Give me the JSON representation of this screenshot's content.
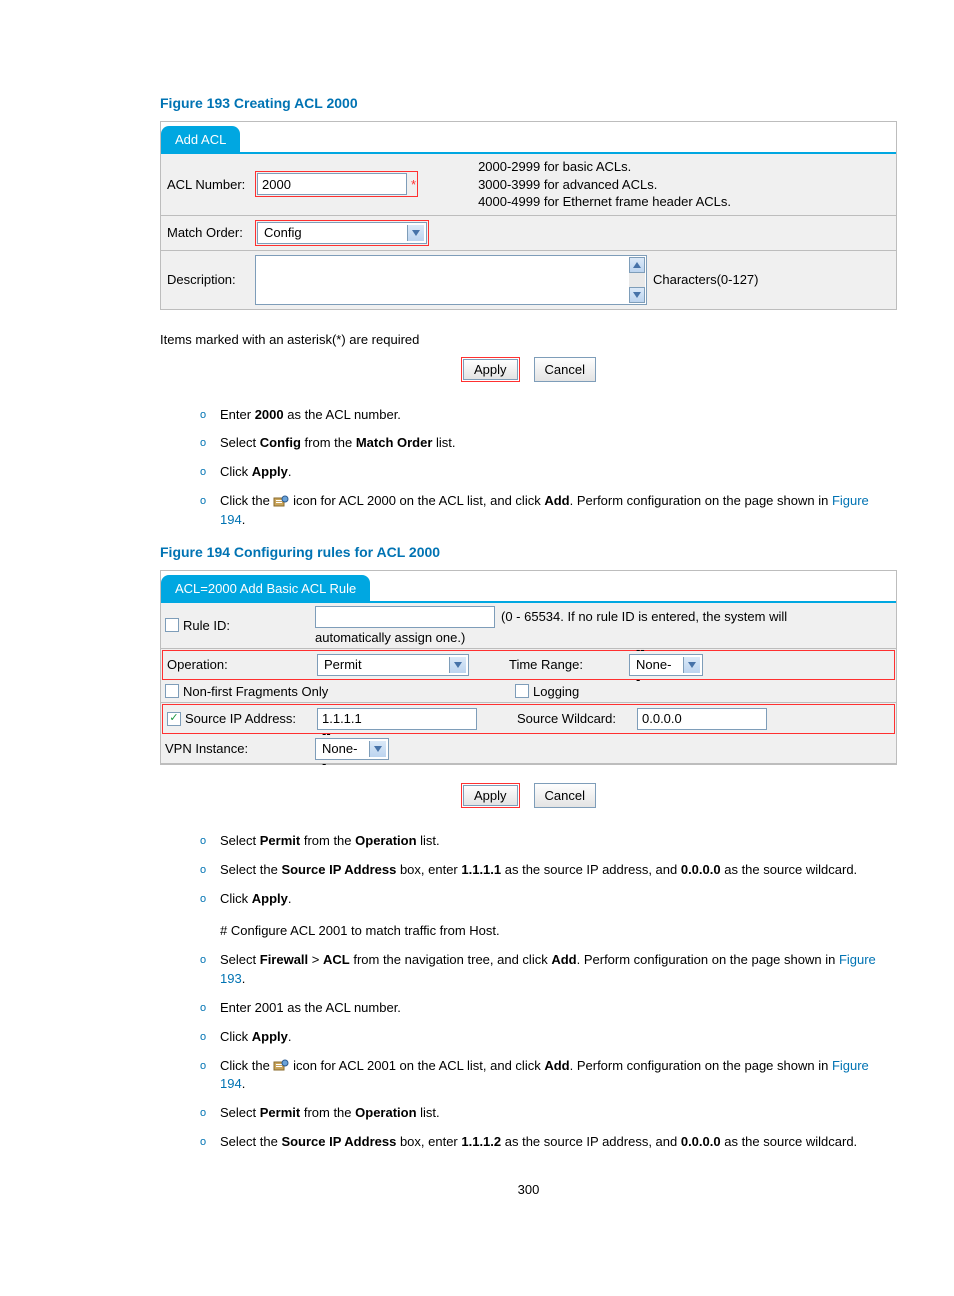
{
  "figure193": {
    "title": "Figure 193 Creating ACL 2000",
    "tab": "Add ACL",
    "acl_label": "ACL Number:",
    "acl_value": "2000",
    "help1": "2000-2999 for basic ACLs.",
    "help2": "3000-3999 for advanced ACLs.",
    "help3": "4000-4999 for Ethernet frame header ACLs.",
    "match_label": "Match Order:",
    "match_value": "Config",
    "desc_label": "Description:",
    "chars_hint": "Characters(0-127)",
    "note": "Items marked with an asterisk(*) are required",
    "apply": "Apply",
    "cancel": "Cancel"
  },
  "inst1": {
    "l1a": "Enter ",
    "l1b": "2000",
    "l1c": " as the ACL number.",
    "l2a": "Select ",
    "l2b": "Config",
    "l2c": " from the ",
    "l2d": "Match Order",
    "l2e": " list.",
    "l3a": "Click ",
    "l3b": "Apply",
    "l3c": ".",
    "l4a": "Click the ",
    "l4b": " icon for ACL 2000 on the ACL list, and click ",
    "l4c": "Add",
    "l4d": ". Perform configuration on the page shown in ",
    "l4e": "Figure 194",
    "l4f": "."
  },
  "figure194": {
    "title": "Figure 194 Configuring rules for ACL 2000",
    "tab": "ACL=2000 Add Basic ACL Rule",
    "ruleid_label": "Rule ID:",
    "ruleid_hint1": "(0 - 65534. If no rule ID is entered, the system will",
    "ruleid_hint2": "automatically assign one.)",
    "op_label": "Operation:",
    "op_value": "Permit",
    "tr_label": "Time Range:",
    "tr_value": "--None--",
    "frag_label": "Non-first Fragments Only",
    "log_label": "Logging",
    "sip_label": "Source IP Address:",
    "sip_value": "1.1.1.1",
    "sw_label": "Source Wildcard:",
    "sw_value": "0.0.0.0",
    "vpn_label": "VPN Instance:",
    "vpn_value": "--None--",
    "apply": "Apply",
    "cancel": "Cancel"
  },
  "inst2": {
    "l1a": "Select ",
    "l1b": "Permit",
    "l1c": " from the ",
    "l1d": "Operation",
    "l1e": " list.",
    "l2a": "Select the ",
    "l2b": "Source IP Address",
    "l2c": " box, enter ",
    "l2d": "1.1.1.1",
    "l2e": " as the source IP address, and ",
    "l2f": "0.0.0.0",
    "l2g": " as the source wildcard.",
    "l3a": "Click ",
    "l3b": "Apply",
    "l3c": ".",
    "hash": "# Configure ACL 2001 to match traffic from Host.",
    "l4a": "Select ",
    "l4b": "Firewall",
    "l4c": " > ",
    "l4d": "ACL",
    "l4e": " from the navigation tree, and click ",
    "l4f": "Add",
    "l4g": ". Perform configuration on the page shown in ",
    "l4h": "Figure 193",
    "l4i": ".",
    "l5": "Enter 2001 as the ACL number.",
    "l6a": "Click ",
    "l6b": "Apply",
    "l6c": ".",
    "l7a": "Click the ",
    "l7b": " icon for ACL 2001 on the ACL list, and click ",
    "l7c": "Add",
    "l7d": ". Perform configuration on the page shown in ",
    "l7e": "Figure 194",
    "l7f": ".",
    "l8a": "Select ",
    "l8b": "Permit",
    "l8c": " from the ",
    "l8d": "Operation",
    "l8e": " list.",
    "l9a": "Select the ",
    "l9b": "Source IP Address",
    "l9c": " box, enter ",
    "l9d": "1.1.1.2",
    "l9e": " as the source IP address, and ",
    "l9f": "0.0.0.0",
    "l9g": " as the source wildcard."
  },
  "page_no": "300"
}
